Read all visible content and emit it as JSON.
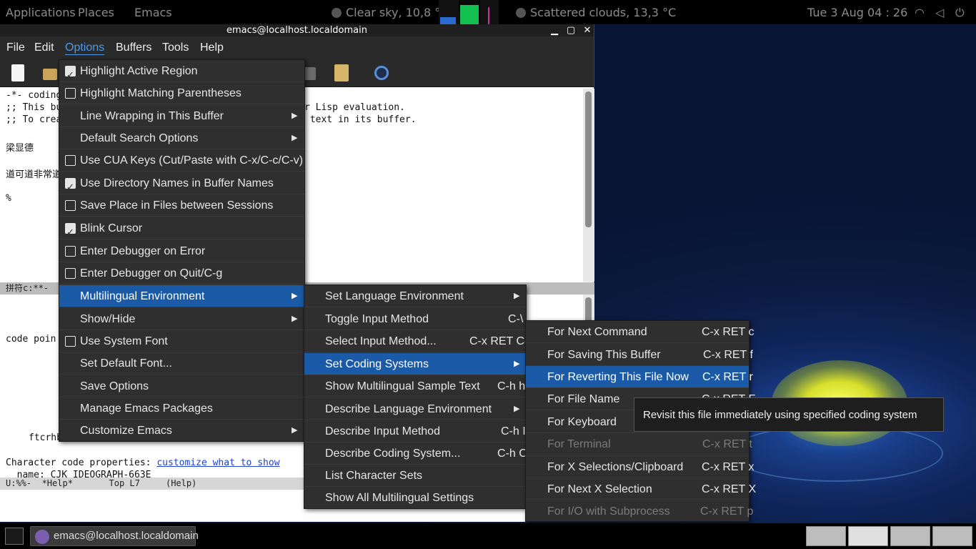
{
  "top_panel": {
    "applications": "Applications",
    "places": "Places",
    "app_name": "Emacs",
    "weather_local": "Clear sky, 10,8 °C",
    "weather_remote": "Scattered clouds, 13,3 °C",
    "clock": "Tue 3 Aug  04 : 26"
  },
  "window": {
    "title": "emacs@localhost.localdomain",
    "minimize": "▁",
    "maximize": "▢",
    "close": "✕"
  },
  "menubar": [
    "File",
    "Edit",
    "Options",
    "Buffers",
    "Tools",
    "Help"
  ],
  "buffer_top": {
    "lines": [
      "-*- coding",
      ";; This bu",
      ";; To crea",
      "梁显德",
      "道可道非常道",
      "%"
    ],
    "right_lines": [
      "r Lisp evaluation.",
      " text in its buffer."
    ]
  },
  "modeline_top": "拼符c:**-",
  "buffer_bottom": {
    "code_point": "code poin",
    "ftcrhb": "ftcrhb:",
    "char_props": "Character code properties: ",
    "customize_link": "customize what to show",
    "name_line": "  name: CJK IDEOGRAPH-663E"
  },
  "modeline_bottom": "U:%%-  *Help*       Top L7     (Help)",
  "options_menu": [
    {
      "label": "Highlight Active Region",
      "check": true
    },
    {
      "label": "Highlight Matching Parentheses",
      "check": false
    },
    {
      "label": "Line Wrapping in This Buffer",
      "submenu": true
    },
    {
      "label": "Default Search Options",
      "submenu": true
    },
    {
      "label": "Use CUA Keys (Cut/Paste with C-x/C-c/C-v)",
      "check": false
    },
    {
      "label": "Use Directory Names in Buffer Names",
      "check": true
    },
    {
      "label": "Save Place in Files between Sessions",
      "check": false
    },
    {
      "label": "Blink Cursor",
      "check": true
    },
    {
      "label": "Enter Debugger on Error",
      "check": false
    },
    {
      "label": "Enter Debugger on Quit/C-g",
      "check": false
    },
    {
      "label": "Multilingual Environment",
      "submenu": true,
      "selected": true
    },
    {
      "label": "Show/Hide",
      "submenu": true
    },
    {
      "label": "Use System Font",
      "check": false
    },
    {
      "label": "Set Default Font..."
    },
    {
      "label": "Save Options"
    },
    {
      "label": "Manage Emacs Packages"
    },
    {
      "label": "Customize Emacs",
      "submenu": true
    }
  ],
  "mule_menu": [
    {
      "label": "Set Language Environment",
      "submenu": true
    },
    {
      "label": "Toggle Input Method",
      "key": "C-\\"
    },
    {
      "label": "Select Input Method...",
      "key": "C-x RET C-\\"
    },
    {
      "label": "Set Coding Systems",
      "submenu": true,
      "selected": true
    },
    {
      "label": "Show Multilingual Sample Text",
      "key": "C-h h"
    },
    {
      "label": "Describe Language Environment",
      "submenu": true
    },
    {
      "label": "Describe Input Method",
      "key": "C-h I"
    },
    {
      "label": "Describe Coding System...",
      "key": "C-h C"
    },
    {
      "label": "List Character Sets"
    },
    {
      "label": "Show All Multilingual Settings"
    }
  ],
  "coding_menu": [
    {
      "label": "For Next Command",
      "key": "C-x RET c"
    },
    {
      "label": "For Saving This Buffer",
      "key": "C-x RET f"
    },
    {
      "label": "For Reverting This File Now",
      "key": "C-x RET r",
      "selected": true
    },
    {
      "label": "For File Name",
      "key": "C-x RET F"
    },
    {
      "label": "For Keyboard",
      "key": "C-x RET k"
    },
    {
      "label": "For Terminal",
      "key": "C-x RET t",
      "disabled": true
    },
    {
      "label": "For X Selections/Clipboard",
      "key": "C-x RET x"
    },
    {
      "label": "For Next X Selection",
      "key": "C-x RET X"
    },
    {
      "label": "For I/O with Subprocess",
      "key": "C-x RET p",
      "disabled": true
    }
  ],
  "tooltip": "Revisit this file immediately using specified coding system",
  "taskbar": {
    "task_label": "emacs@localhost.localdomain"
  },
  "colors": {
    "menu_bg": "#2f2f2f",
    "selection": "#1b5aa6",
    "accent": "#4c9be8"
  }
}
